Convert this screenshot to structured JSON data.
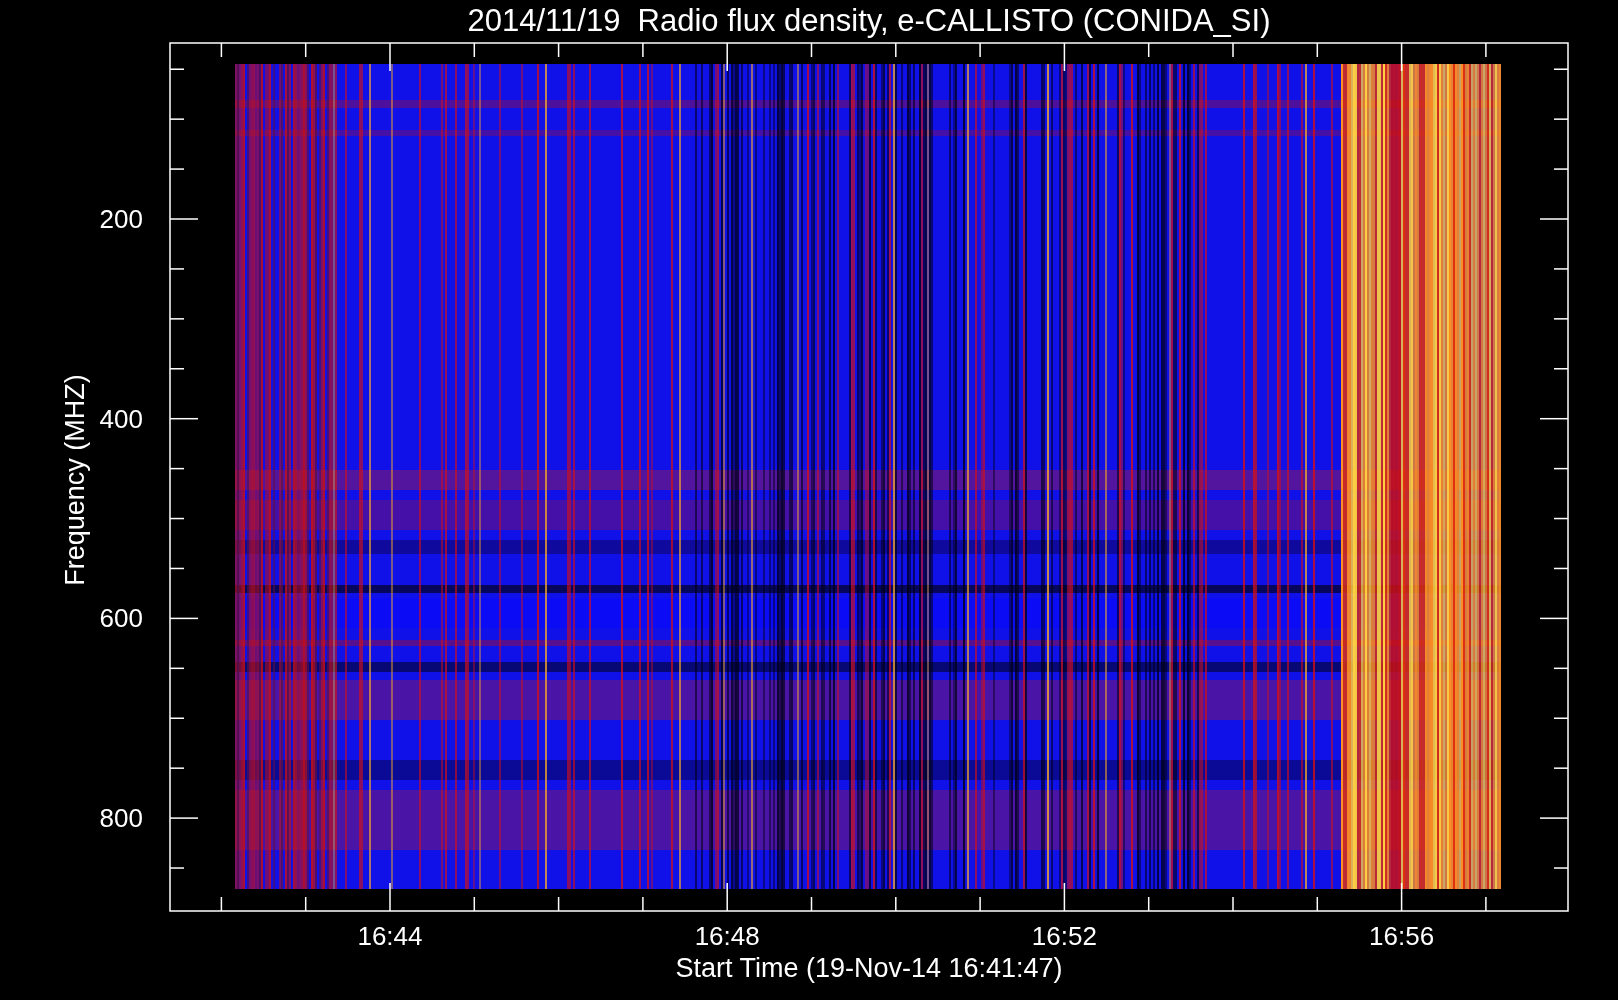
{
  "title": "2014/11/19  Radio flux density, e-CALLISTO (CONIDA_SI)",
  "y_axis": {
    "label": "Frequency (MHZ)",
    "ticks": [
      "200",
      "400",
      "600",
      "800"
    ]
  },
  "x_axis": {
    "label": "Start Time (19-Nov-14 16:41:47)",
    "ticks": [
      "16:44",
      "16:48",
      "16:52",
      "16:56"
    ]
  }
}
